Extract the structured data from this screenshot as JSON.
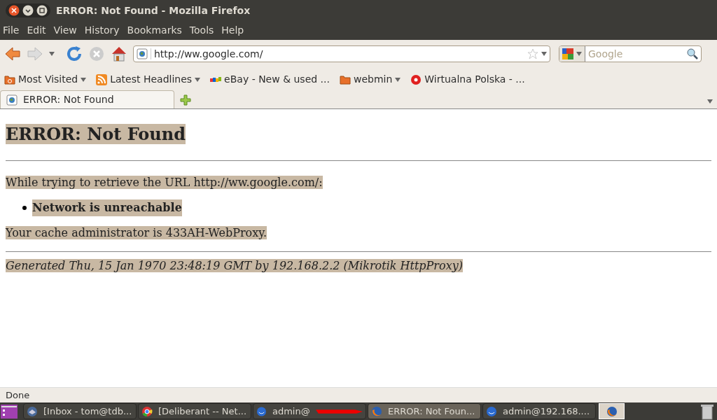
{
  "window": {
    "title": "ERROR: Not Found - Mozilla Firefox"
  },
  "menu": [
    "File",
    "Edit",
    "View",
    "History",
    "Bookmarks",
    "Tools",
    "Help"
  ],
  "url": "http://ww.google.com/",
  "search": {
    "placeholder": "Google"
  },
  "bookmarks": [
    {
      "label": "Most Visited",
      "kind": "folder-smart",
      "dropdown": true
    },
    {
      "label": "Latest Headlines",
      "kind": "feed",
      "dropdown": true
    },
    {
      "label": "eBay - New & used ...",
      "kind": "ebay",
      "dropdown": false
    },
    {
      "label": "webmin",
      "kind": "folder",
      "dropdown": true
    },
    {
      "label": "Wirtualna Polska - ...",
      "kind": "wp",
      "dropdown": false
    }
  ],
  "tabs": [
    {
      "label": "ERROR: Not Found",
      "selected": true
    }
  ],
  "page": {
    "heading": "ERROR: Not Found",
    "intro": "While trying to retrieve the URL http://ww.google.com/:",
    "bullets": [
      "Network is unreachable"
    ],
    "admin": "Your cache administrator is 433AH-WebProxy.",
    "footer": "Generated Thu, 15 Jan 1970 23:48:19 GMT by 192.168.2.2 (Mikrotik HttpProxy)"
  },
  "status_bar": "Done",
  "taskbar": [
    {
      "label": "[Inbox - tom@tdb...",
      "kind": "mail",
      "selected": false
    },
    {
      "label": "[Deliberant -- Net...",
      "kind": "chrome",
      "selected": false
    },
    {
      "label": "admin@",
      "kind": "winbox",
      "selected": false,
      "redacted": true
    },
    {
      "label": "ERROR: Not Foun...",
      "kind": "firefox",
      "selected": true
    },
    {
      "label": "admin@192.168....",
      "kind": "winbox",
      "selected": false
    }
  ]
}
